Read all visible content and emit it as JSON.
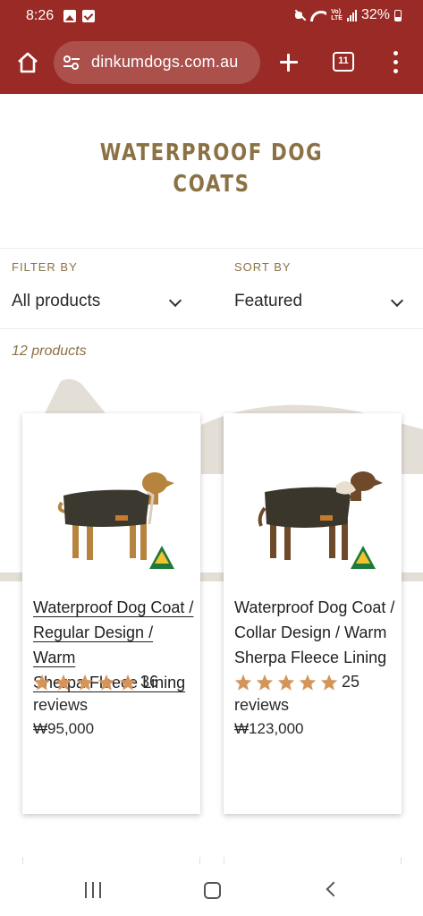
{
  "status_bar": {
    "time": "8:26",
    "battery": "32%",
    "network": "VoLTE"
  },
  "browser": {
    "url": "dinkumdogs.com.au",
    "tab_count": "11",
    "theme_color": "#9a2a25"
  },
  "collection": {
    "title_line1": "WATERPROOF DOG",
    "title_line2": "COATS",
    "filter_label": "FILTER BY",
    "filter_value": "All products",
    "sort_label": "SORT BY",
    "sort_value": "Featured",
    "product_count": "12 products"
  },
  "products": [
    {
      "title_line1": "Waterproof Dog Coat /",
      "title_line2": "Regular Design / Warm",
      "title_line3": "Sherpa Fleece Lining",
      "rating": 5,
      "review_count": "36",
      "review_word": "reviews",
      "price": "₩95,000",
      "image": "dog-in-coat-image",
      "badge": "australian-made-logo"
    },
    {
      "title_line1": "Waterproof Dog Coat /",
      "title_line2": "Collar Design / Warm",
      "title_line3": "Sherpa Fleece Lining",
      "rating": 5,
      "review_count": "25",
      "review_word": "reviews",
      "price": "₩123,000",
      "image": "dog-in-coat-image",
      "badge": "australian-made-logo"
    }
  ],
  "colors": {
    "accent": "#8b7245",
    "star": "#d4955a",
    "chrome": "#9a2a25"
  }
}
